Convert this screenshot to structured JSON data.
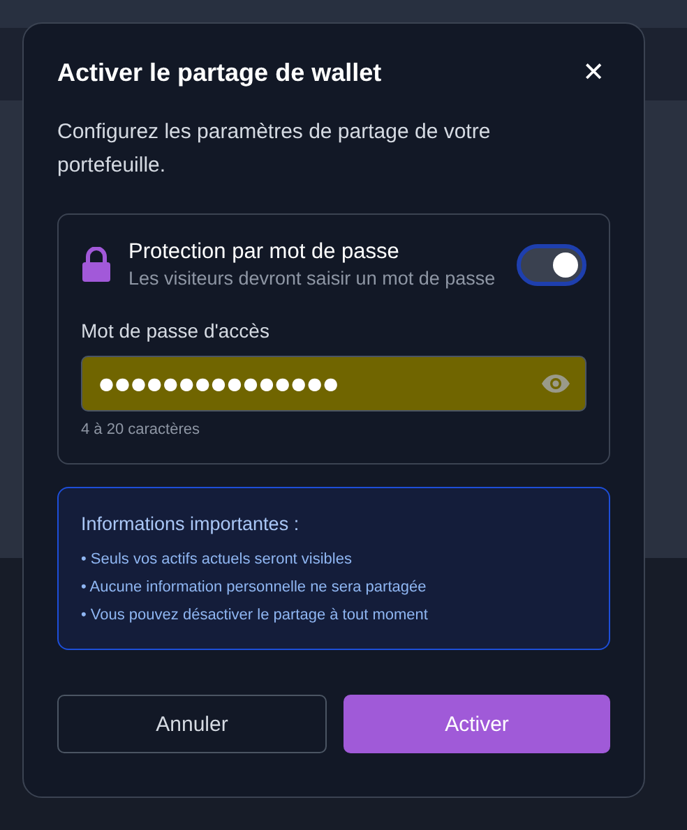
{
  "dialog": {
    "title": "Activer le partage de wallet",
    "close_label": "✕",
    "description": "Configurez les paramètres de partage de votre portefeuille.",
    "protection": {
      "title": "Protection par mot de passe",
      "subtitle": "Les visiteurs devront saisir un mot de passe",
      "on": true
    },
    "password": {
      "label": "Mot de passe d'accès",
      "value": "●●●●●●●●●●●●●●●",
      "hint": "4 à 20 caractères"
    },
    "info": {
      "title": "Informations importantes :",
      "items": [
        "• Seuls vos actifs actuels seront visibles",
        "• Aucune information personnelle ne sera partagée",
        "• Vous pouvez désactiver le partage à tout moment"
      ]
    },
    "buttons": [
      {
        "label": "Annuler",
        "kind": "secondary"
      },
      {
        "label": "Activer",
        "kind": "primary"
      }
    ]
  }
}
